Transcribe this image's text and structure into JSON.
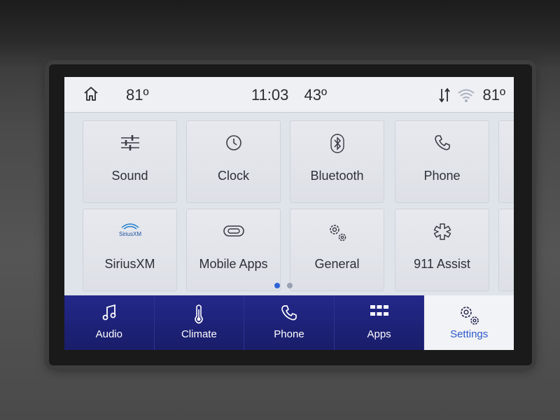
{
  "status_bar": {
    "inside_temp": "81º",
    "time": "11:03",
    "outside_temp": "43º",
    "right_temp": "81º",
    "icons": [
      "home-icon",
      "signal-arrows-icon",
      "wifi-icon"
    ]
  },
  "settings_grid": {
    "tiles": [
      {
        "label": "Sound",
        "icon": "equalizer-icon"
      },
      {
        "label": "Clock",
        "icon": "clock-icon"
      },
      {
        "label": "Bluetooth",
        "icon": "bluetooth-icon"
      },
      {
        "label": "Phone",
        "icon": "phone-icon"
      },
      {
        "label": "SiriusXM",
        "icon": "siriusxm-logo-icon",
        "logo_text": "SiriusXM"
      },
      {
        "label": "Mobile Apps",
        "icon": "mobile-apps-icon"
      },
      {
        "label": "General",
        "icon": "gears-icon"
      },
      {
        "label": "911 Assist",
        "icon": "medical-star-icon"
      }
    ],
    "page_indicator": {
      "current": 1,
      "total": 2
    }
  },
  "dock": {
    "items": [
      {
        "label": "Audio",
        "icon": "music-note-icon"
      },
      {
        "label": "Climate",
        "icon": "thermometer-icon"
      },
      {
        "label": "Phone",
        "icon": "phone-icon"
      },
      {
        "label": "Apps",
        "icon": "apps-grid-icon"
      },
      {
        "label": "Settings",
        "icon": "gears-icon",
        "active": true
      }
    ]
  },
  "colors": {
    "screen_bg": "#dfe3ea",
    "dock_bg": "#1b1f6e",
    "active_accent": "#2a58c8"
  }
}
